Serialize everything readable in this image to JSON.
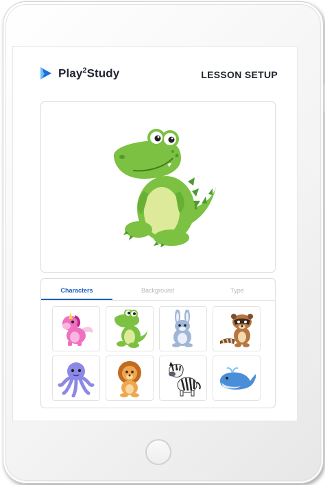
{
  "brand": {
    "name_prefix": "Play",
    "name_sup": "2",
    "name_suffix": "Study"
  },
  "page_title": "LESSON SETUP",
  "preview": {
    "character": "crocodile"
  },
  "tabs": [
    {
      "label": "Characters",
      "active": true
    },
    {
      "label": "Background",
      "active": false
    },
    {
      "label": "Type",
      "active": false
    }
  ],
  "characters": [
    "unicorn",
    "crocodile",
    "bunny",
    "raccoon",
    "octopus",
    "lion",
    "zebra",
    "whale"
  ],
  "colors": {
    "accent": "#1a5fbf",
    "crocodile": "#7cc142",
    "belly": "#dcea9a"
  }
}
